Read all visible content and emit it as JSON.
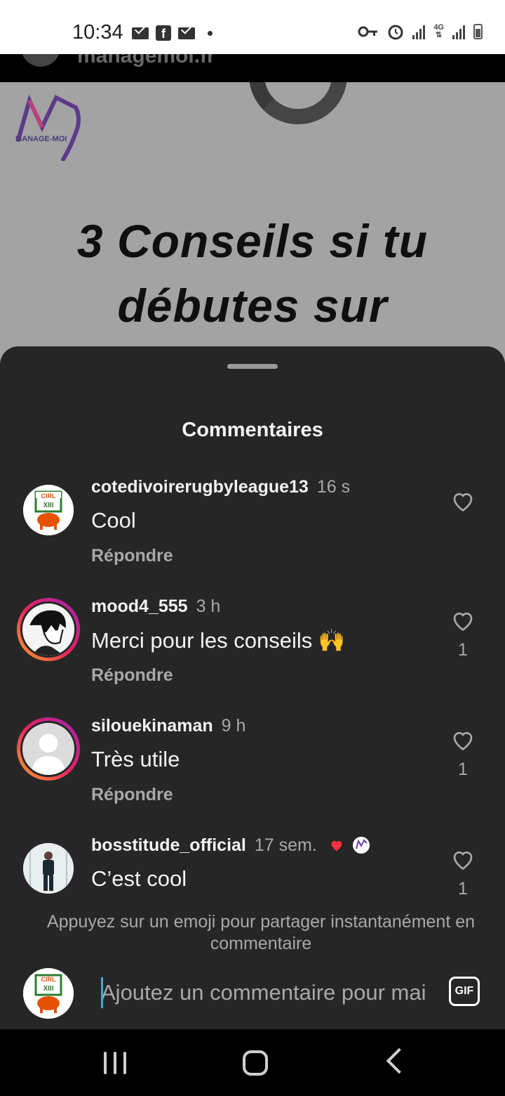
{
  "status_bar": {
    "time": "10:34",
    "network": "4G"
  },
  "post": {
    "handle": "managemoi.fr",
    "logo_text": "MANAGE-MOI",
    "title_line1": "3 Conseils si tu",
    "title_line2": "débutes sur"
  },
  "sheet": {
    "title": "Commentaires",
    "reply_label": "Répondre",
    "comments": [
      {
        "user": "cotedivoirerugbyleague13",
        "time": "16 s",
        "text": "Cool",
        "likes": "",
        "avatar": "cirl-xiii-logo"
      },
      {
        "user": "mood4_555",
        "time": "3 h",
        "text": "Merci pour les conseils 🙌",
        "likes": "1",
        "avatar": "manga-character"
      },
      {
        "user": "silouekinaman",
        "time": "9 h",
        "text": "Très utile",
        "likes": "1",
        "avatar": "default-avatar"
      },
      {
        "user": "bosstitude_official",
        "time": "17 sem.",
        "text": "C’est cool",
        "likes": "1",
        "avatar": "person-photo"
      }
    ],
    "hint": "Appuyez sur un emoji pour partager instantanément en commentaire",
    "composer": {
      "placeholder": "Ajoutez un commentaire pour mai",
      "gif_label": "GIF"
    }
  },
  "colors": {
    "sheet_bg": "#262626",
    "heart_red": "#ff3040",
    "caret": "#4ea3d6"
  }
}
